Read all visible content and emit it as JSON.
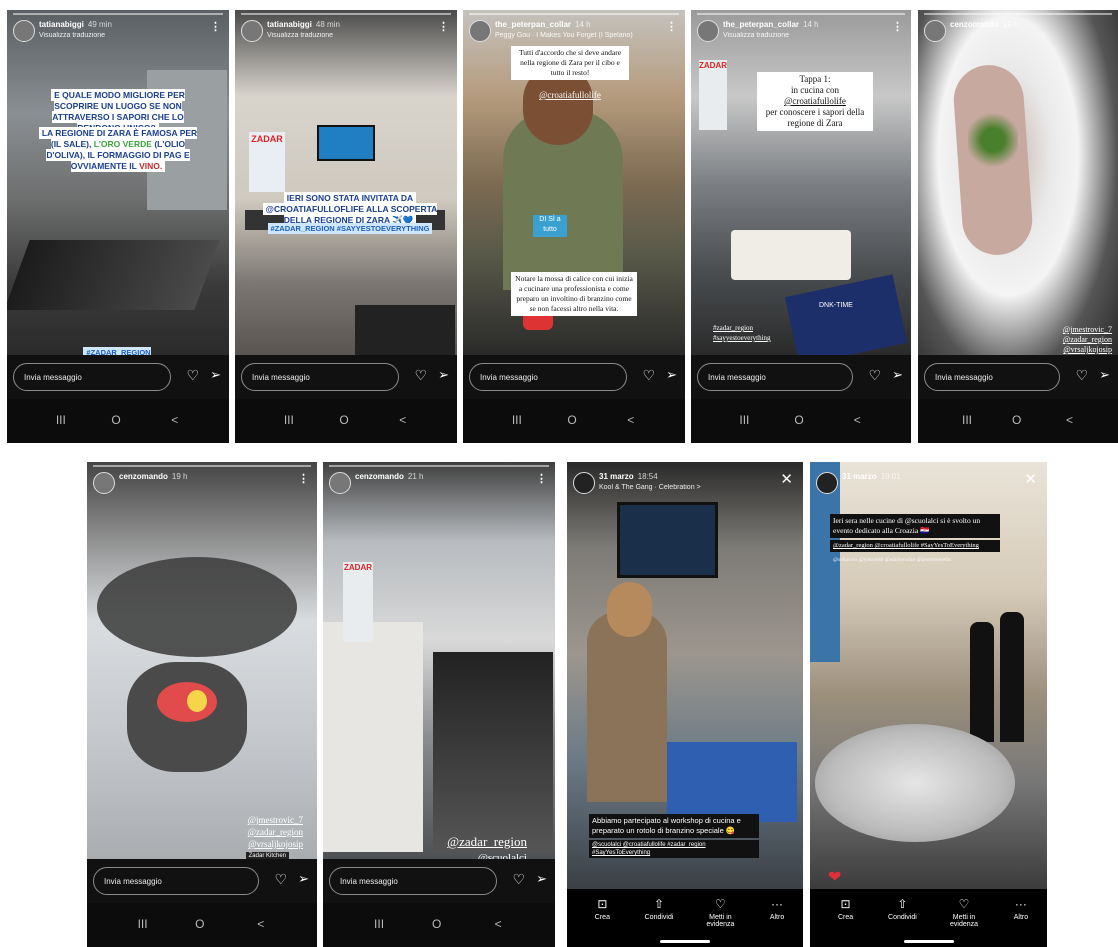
{
  "common": {
    "message_placeholder": "Invia messaggio",
    "nav": [
      "III",
      "O",
      "<"
    ],
    "heart": "♡",
    "send": "➢",
    "more": "⋮",
    "close": "✕"
  },
  "s1": {
    "user": "tatianabiggi",
    "time": "49 min",
    "sub": "Visualizza traduzione",
    "cap1": "E QUALE MODO MIGLIORE PER SCOPRIRE UN LUOGO SE NON ATTRAVERSO I SAPORI CHE LO RENDONO UNICO?",
    "cap2a": "LA REGIONE DI ZARA È FAMOSA PER",
    "cap2b": "(IL SALE),",
    "cap2c": "L'ORO VERDE",
    "cap2d": "(L'OLIO D'OLIVA), IL FORMAGGIO DI PAG E OVVIAMENTE IL",
    "cap2e": "VINO.",
    "tags": "#ZADAR_REGION #SAYYESTOEVERYTHING @CROATIAFULLOFLIFE"
  },
  "s2": {
    "user": "tatianabiggi",
    "time": "48 min",
    "sub": "Visualizza traduzione",
    "poster": "ZADAR",
    "cap1": "IERI SONO STATA INVITATA DA",
    "cap2": "@CROATIAFULLOFLIFE ALLA SCOPERTA DELLA REGIONE DI ZARA ✈️💙",
    "tags": "#ZADAR_REGION #SAYYESTOEVERYTHING"
  },
  "s3": {
    "user": "the_peterpan_collar",
    "time": "14 h",
    "sub": "Peggy Gou · I Makes You Forget (I Spelano)",
    "cap1": "Tutti d'accordo che si deve andare nella regione di Zara per il cibo e tutto il resto!",
    "mention": "@croatiafullolife",
    "apron": "DI SÌ a tutto",
    "cap2": "Notare la mossa di calice con cui inizia a cucinare una professionista e come preparo un involtino di branzino come se non facessi altro nella vita."
  },
  "s4": {
    "user": "the_peterpan_collar",
    "time": "14 h",
    "sub": "Visualizza traduzione",
    "poster": "ZADAR",
    "cap1": "Tappa 1:",
    "cap2": "in cucina con",
    "mention": "@croatiafullolife",
    "cap3": "per conoscere i sapori della regione di Zara",
    "tag1": "#zadar_region",
    "tag2": "#sayyestoeverything",
    "card": "DNK-TIME"
  },
  "s5": {
    "user": "cenzomando",
    "time": "19 h",
    "tags": [
      "@jmestrovic_7",
      "@zadar_region",
      "@vrsaljkojosip"
    ]
  },
  "s6": {
    "user": "cenzomando",
    "time": "19 h",
    "tags": [
      "@jmestrovic_7",
      "@zadar_region",
      "@vrsaljkojosip"
    ],
    "small": "Zadar Kitchen"
  },
  "s7": {
    "user": "cenzomando",
    "time": "21 h",
    "poster": "ZADAR",
    "tag1": "@zadar_region",
    "tag2": "@scuolalci"
  },
  "s8": {
    "date": "31 marzo",
    "time": "18:54",
    "sub": "Kool & The Gang · Celebration >",
    "cap1": "Abbiamo partecipato al workshop di cucina e preparato un rotolo di branzino speciale 😋",
    "cap2": "@scuolalci @croatiafullolife #zadar_region #SayYesToEverything",
    "actions": [
      "Crea",
      "Condividi",
      "Metti in evidenza",
      "Altro"
    ]
  },
  "s9": {
    "date": "31 marzo",
    "time": "19:01",
    "cap1": "Ieri sera nelle cucine di @scuolalci si è svolto un evento dedicato alla Croazia 🇭🇷",
    "cap2": "@zadar_region @croatiafullolife #SayYesToEverything",
    "cap3": "@sellaroro @yokodidi @adoberocke @pemtrmelefm",
    "actions": [
      "Crea",
      "Condividi",
      "Metti in evidenza",
      "Altro"
    ]
  }
}
